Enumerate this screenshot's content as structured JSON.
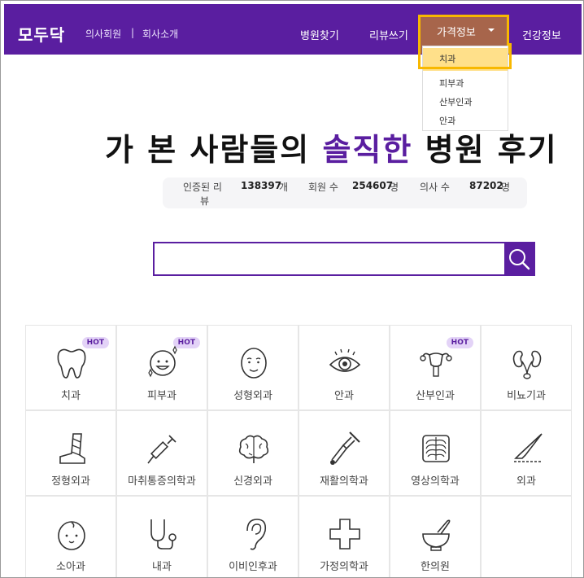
{
  "header": {
    "logo": "모두닥",
    "sub_links": [
      "의사회원",
      "회사소개"
    ],
    "separator": "|",
    "nav": [
      "병원찾기",
      "리뷰쓰기",
      "가격정보",
      "건강정보"
    ]
  },
  "dropdown": {
    "items": [
      "치과",
      "피부과",
      "산부인과",
      "안과"
    ],
    "active_index": 0
  },
  "hero": {
    "pre": "가 본 사람들의 ",
    "accent": "솔직한",
    "post": " 병원 후기"
  },
  "stats": {
    "reviews_label_1": "인증된 리",
    "reviews_label_2": "뷰",
    "reviews_value": "138397",
    "reviews_unit": "개",
    "members_label": "회원 수",
    "members_value": "254607",
    "members_unit": "명",
    "doctors_label": "의사 수",
    "doctors_value": "87202",
    "doctors_unit": "명"
  },
  "search": {
    "placeholder": "",
    "value": ""
  },
  "specialties": [
    {
      "label": "치과",
      "hot": "HOT",
      "icon": "tooth-icon"
    },
    {
      "label": "피부과",
      "hot": "HOT",
      "icon": "face-sparkle-icon"
    },
    {
      "label": "성형외과",
      "hot": "",
      "icon": "face-icon"
    },
    {
      "label": "안과",
      "hot": "",
      "icon": "eye-icon"
    },
    {
      "label": "산부인과",
      "hot": "HOT",
      "icon": "uterus-icon"
    },
    {
      "label": "비뇨기과",
      "hot": "",
      "icon": "kidney-icon"
    },
    {
      "label": "정형외과",
      "hot": "",
      "icon": "cast-leg-icon"
    },
    {
      "label": "마취통증의학과",
      "hot": "",
      "icon": "syringe-icon"
    },
    {
      "label": "신경외과",
      "hot": "",
      "icon": "brain-icon"
    },
    {
      "label": "재활의학과",
      "hot": "",
      "icon": "crutch-icon"
    },
    {
      "label": "영상의학과",
      "hot": "",
      "icon": "xray-ribs-icon"
    },
    {
      "label": "외과",
      "hot": "",
      "icon": "scalpel-icon"
    },
    {
      "label": "소아과",
      "hot": "",
      "icon": "baby-face-icon"
    },
    {
      "label": "내과",
      "hot": "",
      "icon": "stethoscope-icon"
    },
    {
      "label": "이비인후과",
      "hot": "",
      "icon": "ear-icon"
    },
    {
      "label": "가정의학과",
      "hot": "",
      "icon": "medical-cross-icon"
    },
    {
      "label": "한의원",
      "hot": "",
      "icon": "mortar-pestle-icon"
    }
  ],
  "colors": {
    "brand": "#5a1ea0",
    "active_tab": "#a7654b",
    "highlight": "#f8b800",
    "hot_badge_bg": "#e3d3f7"
  }
}
